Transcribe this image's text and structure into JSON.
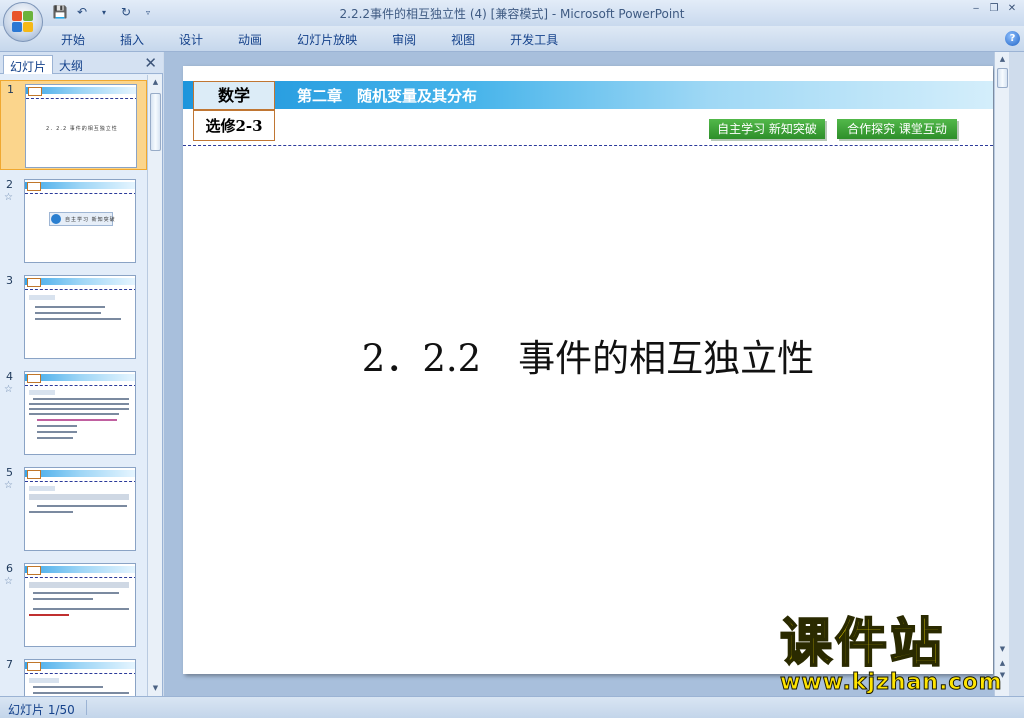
{
  "window": {
    "title": "2.2.2事件的相互独立性 (4) [兼容模式] - Microsoft PowerPoint"
  },
  "ribbon": {
    "tabs": [
      "开始",
      "插入",
      "设计",
      "动画",
      "幻灯片放映",
      "审阅",
      "视图",
      "开发工具"
    ]
  },
  "pane": {
    "tab_slides": "幻灯片",
    "tab_outline": "大纲",
    "thumbnails": [
      {
        "num": "1",
        "caption": "2．2.2 事件的相互独立性",
        "selected": true
      },
      {
        "num": "2",
        "caption": "自主学习 新知突破"
      },
      {
        "num": "3",
        "caption": ""
      },
      {
        "num": "4",
        "caption": ""
      },
      {
        "num": "5",
        "caption": ""
      },
      {
        "num": "6",
        "caption": ""
      },
      {
        "num": "7",
        "caption": ""
      }
    ]
  },
  "slide": {
    "subject": "数学",
    "course": "选修2-3",
    "chapter": "第二章　随机变量及其分布",
    "button1": "自主学习 新知突破",
    "button2": "合作探究 课堂互动",
    "title": "2．2.2　事件的相互独立性"
  },
  "status": {
    "slide_counter": "幻灯片 1/50"
  },
  "watermark": {
    "brand": "课件站",
    "url": "www.kjzhan.com"
  },
  "colors": {
    "band_start": "#1d95dc",
    "button_green": "#3ea037",
    "selection": "#fbd58c"
  }
}
